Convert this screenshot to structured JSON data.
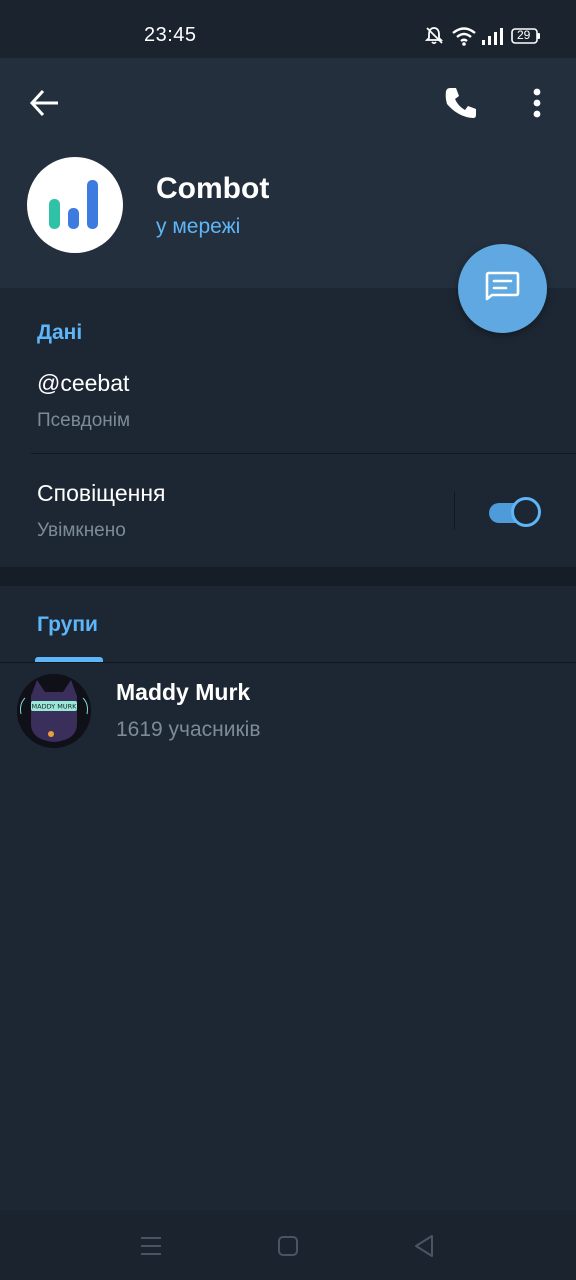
{
  "status_bar": {
    "time": "23:45",
    "battery": "29",
    "icons": [
      "bell-muted-icon",
      "wifi-icon",
      "signal-icon",
      "battery-icon"
    ]
  },
  "header": {
    "icons": [
      "back-arrow-icon",
      "phone-icon",
      "more-vertical-icon"
    ],
    "name": "Combot",
    "status": "у мережі",
    "avatar_icon": "bar-chart-logo"
  },
  "fab": {
    "icon": "message-icon"
  },
  "info": {
    "title": "Дані",
    "username": "@ceebat",
    "username_label": "Псевдонім",
    "notifications_title": "Сповіщення",
    "notifications_status": "Увімкнено",
    "notifications_enabled": true
  },
  "groups": {
    "tab_label": "Групи",
    "items": [
      {
        "name": "Maddy Murk",
        "members": "1619 учасників",
        "avatar_text": "MADDY MURK"
      }
    ]
  },
  "nav_bar": {
    "icons": [
      "recents-icon",
      "home-icon",
      "back-triangle-icon"
    ]
  },
  "colors": {
    "accent": "#5eb5f7",
    "header_bg": "#232f3d",
    "page_bg": "#1d2733",
    "fab_bg": "#5fa8e1",
    "secondary_text": "#7d8b99"
  }
}
